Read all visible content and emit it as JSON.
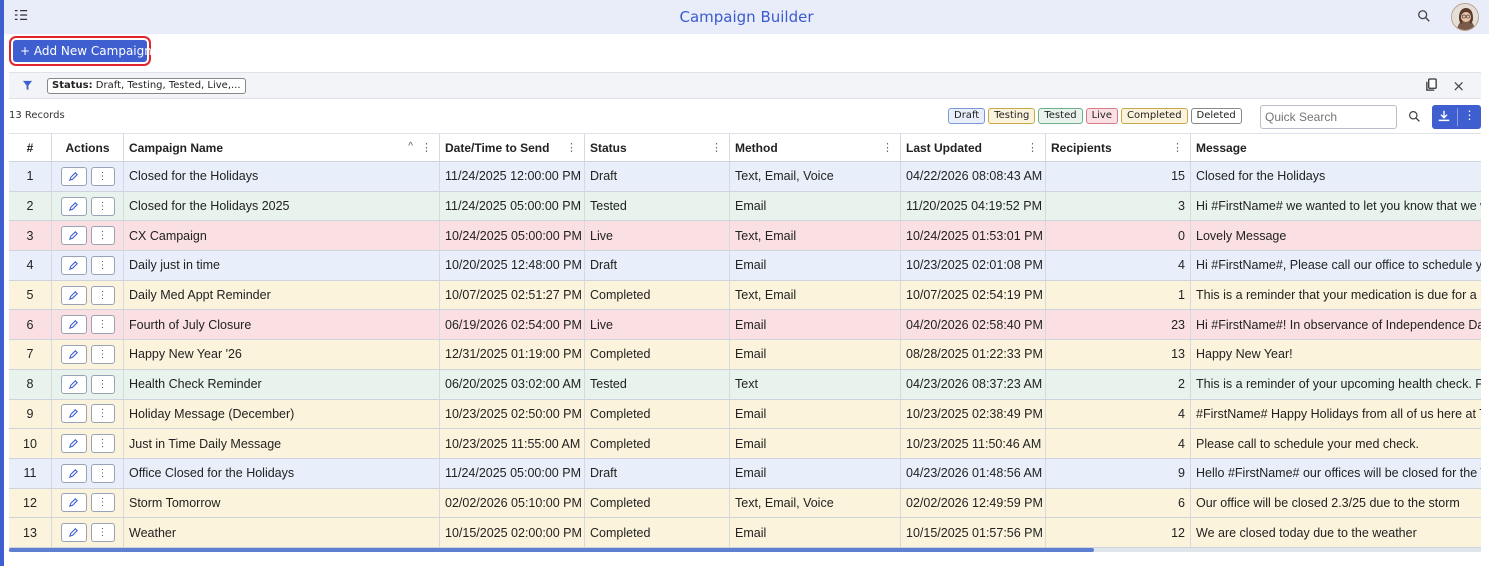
{
  "app": {
    "title": "Campaign Builder",
    "accent_color": "#3f5fd0",
    "icons": {
      "menu": "menu-collapse-icon",
      "search": "search-icon",
      "avatar": "user-avatar"
    }
  },
  "toolbar": {
    "add_label": "+ Add New Campaign"
  },
  "filter": {
    "label": "Status:",
    "value": "Draft, Testing, Tested, Live,...",
    "icons": {
      "filter": "filter-icon",
      "copy": "copy-icon",
      "close": "close-icon"
    }
  },
  "records": {
    "count_label": "13 Records"
  },
  "legend": [
    {
      "label": "Draft",
      "bg": "#e8effa",
      "border": "#7d97d6"
    },
    {
      "label": "Testing",
      "bg": "#fbf3dc",
      "border": "#c8a84e"
    },
    {
      "label": "Tested",
      "bg": "#e7f3ec",
      "border": "#6fae88"
    },
    {
      "label": "Live",
      "bg": "#fbe0e3",
      "border": "#d77b86"
    },
    {
      "label": "Completed",
      "bg": "#fbf3dc",
      "border": "#c8a84e"
    },
    {
      "label": "Deleted",
      "bg": "#ffffff",
      "border": "#888888"
    }
  ],
  "search": {
    "placeholder": "Quick Search"
  },
  "columns": {
    "num": "#",
    "actions": "Actions",
    "name": "Campaign Name",
    "date": "Date/Time to Send",
    "status": "Status",
    "method": "Method",
    "updated": "Last Updated",
    "recipients": "Recipients",
    "message": "Message"
  },
  "rows": [
    {
      "num": "1",
      "name": "Closed for the Holidays",
      "date": "11/24/2025 12:00:00 PM",
      "status": "Draft",
      "method": "Text, Email, Voice",
      "updated": "04/22/2026 08:08:43 AM",
      "recipients": "15",
      "message": "Closed for the Holidays",
      "cls": "s-draft"
    },
    {
      "num": "2",
      "name": "Closed for the Holidays 2025",
      "date": "11/24/2025 05:00:00 PM",
      "status": "Tested",
      "method": "Email",
      "updated": "11/20/2025 04:19:52 PM",
      "recipients": "3",
      "message": "Hi #FirstName# we wanted to let you know that we wi",
      "cls": "s-tested"
    },
    {
      "num": "3",
      "name": "CX Campaign",
      "date": "10/24/2025 05:00:00 PM",
      "status": "Live",
      "method": "Text, Email",
      "updated": "10/24/2025 01:53:01 PM",
      "recipients": "0",
      "message": "Lovely Message",
      "cls": "s-live"
    },
    {
      "num": "4",
      "name": "Daily just in time",
      "date": "10/20/2025 12:48:00 PM",
      "status": "Draft",
      "method": "Email",
      "updated": "10/23/2025 02:01:08 PM",
      "recipients": "4",
      "message": "Hi #FirstName#, Please call our office to schedule you",
      "cls": "s-draft"
    },
    {
      "num": "5",
      "name": "Daily Med Appt Reminder",
      "date": "10/07/2025 02:51:27 PM",
      "status": "Completed",
      "method": "Text, Email",
      "updated": "10/07/2025 02:54:19 PM",
      "recipients": "1",
      "message": "This is a reminder that your medication is due for a ref",
      "cls": "s-completed"
    },
    {
      "num": "6",
      "name": "Fourth of July Closure",
      "date": "06/19/2026 02:54:00 PM",
      "status": "Live",
      "method": "Email",
      "updated": "04/20/2026 02:58:40 PM",
      "recipients": "23",
      "message": "Hi #FirstName#! In observance of Independence Day,",
      "cls": "s-live"
    },
    {
      "num": "7",
      "name": "Happy New Year '26",
      "date": "12/31/2025 01:19:00 PM",
      "status": "Completed",
      "method": "Email",
      "updated": "08/28/2025 01:22:33 PM",
      "recipients": "13",
      "message": "Happy New Year!",
      "cls": "s-completed"
    },
    {
      "num": "8",
      "name": "Health Check Reminder",
      "date": "06/20/2025 03:02:00 AM",
      "status": "Tested",
      "method": "Text",
      "updated": "04/23/2026 08:37:23 AM",
      "recipients": "2",
      "message": "This is a reminder of your upcoming health check. Plea",
      "cls": "s-tested"
    },
    {
      "num": "9",
      "name": "Holiday Message (December)",
      "date": "10/23/2025 02:50:00 PM",
      "status": "Completed",
      "method": "Email",
      "updated": "10/23/2025 02:38:49 PM",
      "recipients": "4",
      "message": "#FirstName# Happy Holidays from all of us here at Tra",
      "cls": "s-completed"
    },
    {
      "num": "10",
      "name": "Just in Time Daily Message",
      "date": "10/23/2025 11:55:00 AM",
      "status": "Completed",
      "method": "Email",
      "updated": "10/23/2025 11:50:46 AM",
      "recipients": "4",
      "message": "Please call to schedule your med check.",
      "cls": "s-completed"
    },
    {
      "num": "11",
      "name": "Office Closed for the Holidays",
      "date": "11/24/2025 05:00:00 PM",
      "status": "Draft",
      "method": "Email",
      "updated": "04/23/2026 01:48:56 AM",
      "recipients": "9",
      "message": "Hello #FirstName# our offices will be closed for the Th",
      "cls": "s-draft"
    },
    {
      "num": "12",
      "name": "Storm Tomorrow",
      "date": "02/02/2026 05:10:00 PM",
      "status": "Completed",
      "method": "Text, Email, Voice",
      "updated": "02/02/2026 12:49:59 PM",
      "recipients": "6",
      "message": "Our office will be closed 2.3/25 due to the storm",
      "cls": "s-completed"
    },
    {
      "num": "13",
      "name": "Weather",
      "date": "10/15/2025 02:00:00 PM",
      "status": "Completed",
      "method": "Email",
      "updated": "10/15/2025 01:57:56 PM",
      "recipients": "12",
      "message": "We are closed today due to the weather",
      "cls": "s-completed"
    }
  ]
}
